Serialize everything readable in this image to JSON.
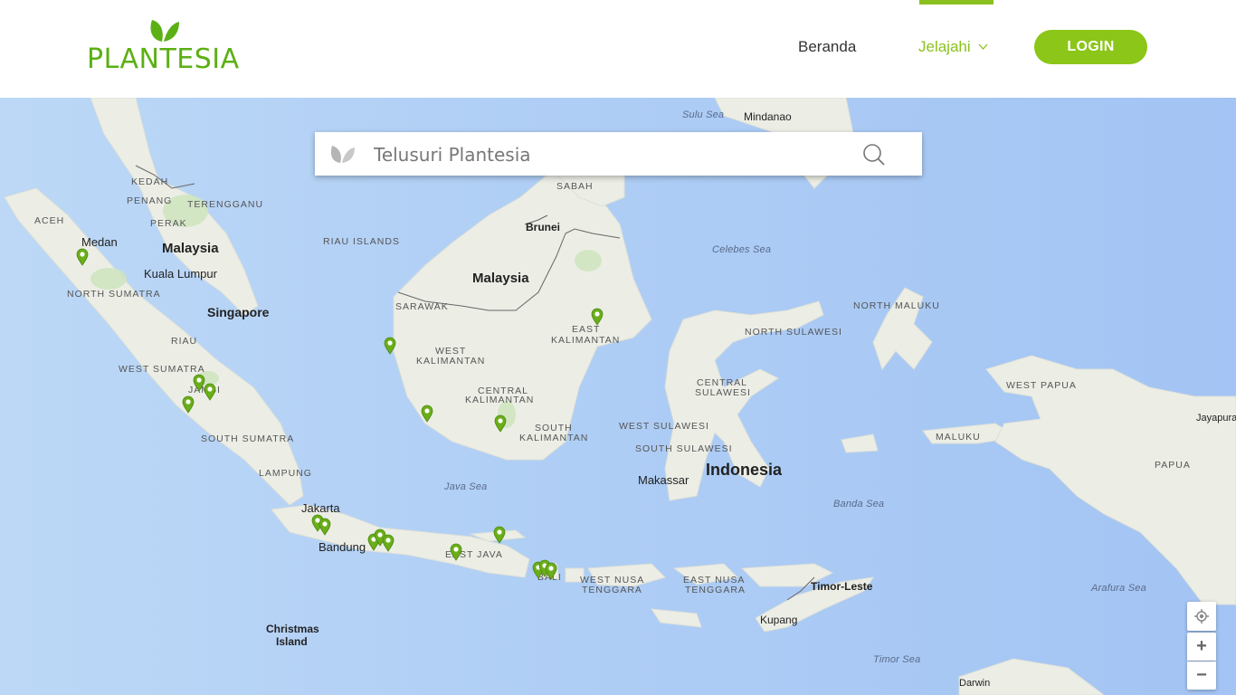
{
  "brand": {
    "name": "PLANTESIA"
  },
  "nav": {
    "beranda": "Beranda",
    "jelajahi": "Jelajahi",
    "login": "LOGIN"
  },
  "search": {
    "placeholder": "Telusuri Plantesia"
  },
  "colors": {
    "brand_green": "#5bb014",
    "accent": "#8bc618",
    "sea": "#a8c8f5",
    "land": "#eceee6"
  },
  "map": {
    "labels": {
      "sulu_sea": "Sulu Sea",
      "mindanao": "Mindanao",
      "kedah": "KEDAH",
      "penang": "PENANG",
      "terengganu": "TERENGGANU",
      "perak": "PERAK",
      "aceh": "ACEH",
      "medan": "Medan",
      "malaysia_w": "Malaysia",
      "kuala_lumpur": "Kuala Lumpur",
      "riau_islands": "RIAU ISLANDS",
      "sabah": "SABAH",
      "brunei": "Brunei",
      "celebes_sea": "Celebes Sea",
      "malaysia_e": "Malaysia",
      "sarawak": "SARAWAK",
      "north_sumatra": "NORTH SUMATRA",
      "singapore": "Singapore",
      "north_maluku": "NORTH MALUKU",
      "east_kalimantan_1": "EAST",
      "east_kalimantan_2": "KALIMANTAN",
      "north_sulawesi": "NORTH SULAWESI",
      "riau": "RIAU",
      "west_kalimantan_1": "WEST",
      "west_kalimantan_2": "KALIMANTAN",
      "west_sumatra": "WEST SUMATRA",
      "jambi": "JAMBI",
      "central_sulawesi_1": "CENTRAL",
      "central_sulawesi_2": "SULAWESI",
      "west_papua": "WEST PAPUA",
      "central_kalimantan_1": "CENTRAL",
      "central_kalimantan_2": "KALIMANTAN",
      "jayapura": "Jayapura",
      "west_sulawesi": "WEST SULAWESI",
      "south_kalimantan_1": "SOUTH",
      "south_kalimantan_2": "KALIMANTAN",
      "maluku": "MALUKU",
      "south_sumatra": "SOUTH SUMATRA",
      "south_sulawesi": "SOUTH SULAWESI",
      "papua": "PAPUA",
      "indonesia": "Indonesia",
      "lampung": "LAMPUNG",
      "makassar": "Makassar",
      "java_sea": "Java Sea",
      "jakarta": "Jakarta",
      "banda_sea": "Banda Sea",
      "bandung": "Bandung",
      "east_java": "EAST JAVA",
      "west_nusa_1": "WEST NUSA",
      "west_nusa_2": "TENGGARA",
      "east_nusa_1": "EAST NUSA",
      "east_nusa_2": "TENGGARA",
      "bali": "BALI",
      "timor_leste": "Timor-Leste",
      "arafura_sea": "Arafura Sea",
      "kupang": "Kupang",
      "christmas_1": "Christmas",
      "christmas_2": "Island",
      "timor_sea": "Timor Sea",
      "darwin": "Darwin"
    }
  },
  "controls": {
    "zoom_in": "+",
    "zoom_out": "−"
  }
}
